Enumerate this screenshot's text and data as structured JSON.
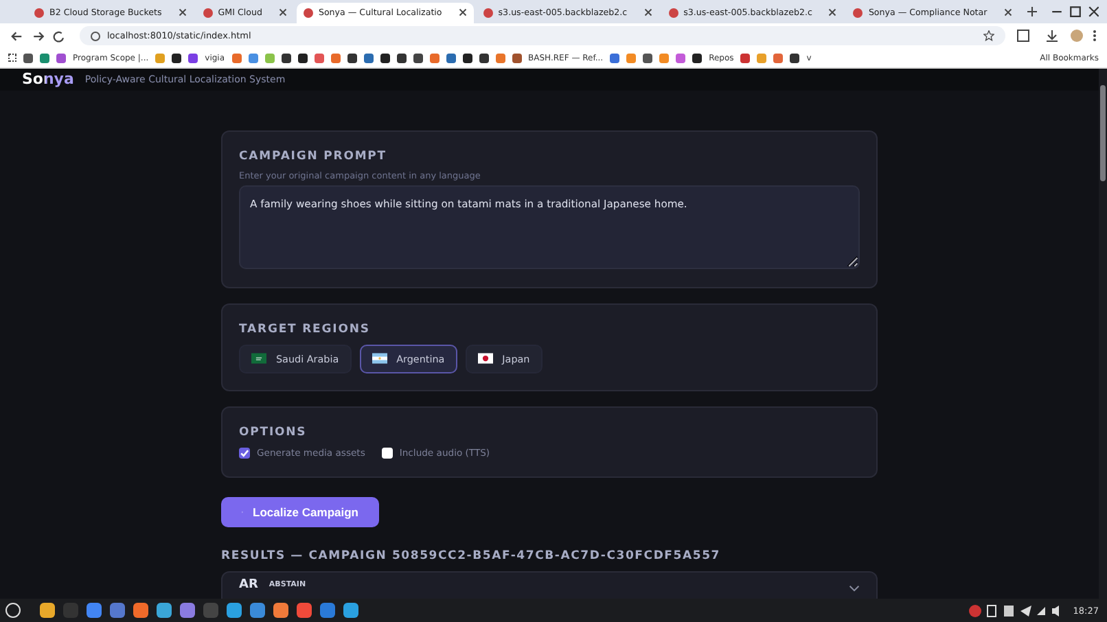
{
  "browser": {
    "tabs": [
      {
        "title": "B2 Cloud Storage Buckets",
        "selected": false
      },
      {
        "title": "GMI Cloud",
        "selected": false
      },
      {
        "title": "Sonya — Cultural Localizatio",
        "selected": true
      },
      {
        "title": "s3.us-east-005.backblazeb2.c",
        "selected": false
      },
      {
        "title": "s3.us-east-005.backblazeb2.c",
        "selected": false
      },
      {
        "title": "Sonya — Compliance Notar",
        "selected": false
      }
    ],
    "url": "localhost:8010/static/index.html",
    "bookmarks": [
      "Program Scope |...",
      "vigia",
      "BASH.REF — Ref...",
      "Repos",
      "v"
    ],
    "all_bookmarks": "All Bookmarks"
  },
  "app": {
    "logo": "Sonya",
    "subtitle": "Policy-Aware Cultural Localization System"
  },
  "prompt": {
    "title": "CAMPAIGN PROMPT",
    "hint": "Enter your original campaign content in any language",
    "value": "A family wearing shoes while sitting on tatami mats in a traditional Japanese home."
  },
  "regions": {
    "title": "TARGET REGIONS",
    "items": [
      {
        "label": "Saudi Arabia",
        "selected": false
      },
      {
        "label": "Argentina",
        "selected": true
      },
      {
        "label": "Japan",
        "selected": false
      }
    ]
  },
  "options": {
    "title": "OPTIONS",
    "items": [
      {
        "label": "Generate media assets",
        "checked": true
      },
      {
        "label": "Include audio (TTS)",
        "checked": false
      }
    ]
  },
  "action": "Localize Campaign",
  "results": {
    "heading": "RESULTS — CAMPAIGN 50859CC2-B5AF-47CB-AC7D-C30FCDF5A557",
    "items": [
      {
        "code": "AR",
        "verdict": "ABSTAIN"
      }
    ]
  },
  "taskbar": {
    "time": "18:27"
  }
}
